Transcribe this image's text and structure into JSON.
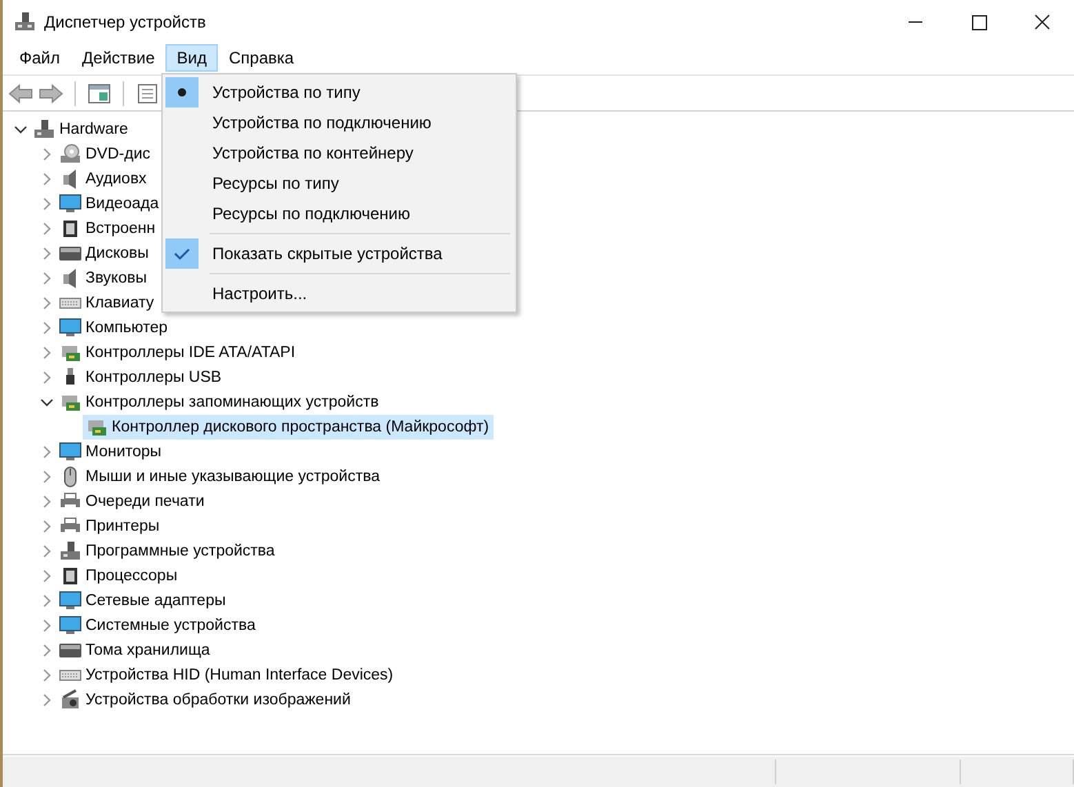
{
  "window": {
    "title": "Диспетчер устройств"
  },
  "menu_bar": [
    {
      "label": "Файл",
      "selected": false
    },
    {
      "label": "Действие",
      "selected": false
    },
    {
      "label": "Вид",
      "selected": true
    },
    {
      "label": "Справка",
      "selected": false
    }
  ],
  "view_menu": [
    {
      "kind": "radio",
      "label": "Устройства по типу",
      "selected": true
    },
    {
      "kind": "radio",
      "label": "Устройства по подключению",
      "selected": false
    },
    {
      "kind": "radio",
      "label": "Устройства по контейнеру",
      "selected": false
    },
    {
      "kind": "radio",
      "label": "Ресурсы по типу",
      "selected": false
    },
    {
      "kind": "radio",
      "label": "Ресурсы по подключению",
      "selected": false
    },
    {
      "kind": "separator"
    },
    {
      "kind": "check",
      "label": "Показать скрытые устройства",
      "checked": true
    },
    {
      "kind": "separator"
    },
    {
      "kind": "plain",
      "label": "Настроить..."
    }
  ],
  "tree": {
    "label": "Hardware",
    "expanded": true,
    "selected": false,
    "children": [
      {
        "label": "DVD-дис",
        "expanded": false,
        "selected": false
      },
      {
        "label": "Аудиовх",
        "expanded": false,
        "selected": false
      },
      {
        "label": "Видеоада",
        "expanded": false,
        "selected": false
      },
      {
        "label": "Встроенн",
        "expanded": false,
        "selected": false
      },
      {
        "label": "Дисковы",
        "expanded": false,
        "selected": false
      },
      {
        "label": "Звуковы",
        "expanded": false,
        "selected": false
      },
      {
        "label": "Клавиату",
        "expanded": false,
        "selected": false
      },
      {
        "label": "Компьютер",
        "expanded": false,
        "selected": false
      },
      {
        "label": "Контроллеры IDE ATA/ATAPI",
        "expanded": false,
        "selected": false
      },
      {
        "label": "Контроллеры USB",
        "expanded": false,
        "selected": false
      },
      {
        "label": "Контроллеры запоминающих устройств",
        "expanded": true,
        "selected": false,
        "children": [
          {
            "label": "Контроллер дискового пространства (Майкрософт)",
            "selected": true
          }
        ]
      },
      {
        "label": "Мониторы",
        "expanded": false,
        "selected": false
      },
      {
        "label": "Мыши и иные указывающие устройства",
        "expanded": false,
        "selected": false
      },
      {
        "label": "Очереди печати",
        "expanded": false,
        "selected": false
      },
      {
        "label": "Принтеры",
        "expanded": false,
        "selected": false
      },
      {
        "label": "Программные устройства",
        "expanded": false,
        "selected": false
      },
      {
        "label": "Процессоры",
        "expanded": false,
        "selected": false
      },
      {
        "label": "Сетевые адаптеры",
        "expanded": false,
        "selected": false
      },
      {
        "label": "Системные устройства",
        "expanded": false,
        "selected": false
      },
      {
        "label": "Тома хранилища",
        "expanded": false,
        "selected": false
      },
      {
        "label": "Устройства HID (Human Interface Devices)",
        "expanded": false,
        "selected": false
      },
      {
        "label": "Устройства обработки изображений",
        "expanded": false,
        "selected": false
      }
    ]
  }
}
